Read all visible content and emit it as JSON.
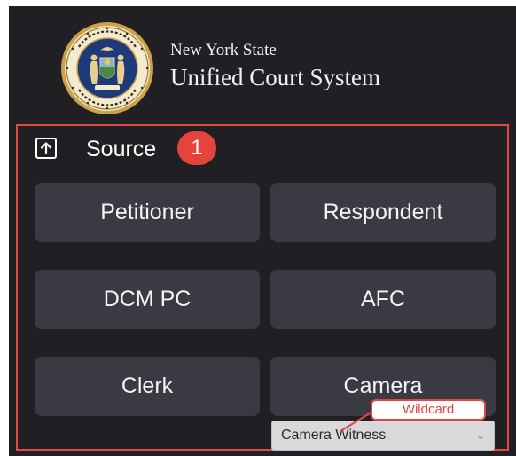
{
  "header": {
    "org_line1": "New York State",
    "org_line2": "Unified Court System",
    "seal_icon": "ny-state-seal-icon"
  },
  "source": {
    "icon": "upload-icon",
    "label": "Source",
    "step_badge": "1"
  },
  "roles": [
    {
      "label": "Petitioner"
    },
    {
      "label": "Respondent"
    },
    {
      "label": "DCM PC"
    },
    {
      "label": "AFC"
    },
    {
      "label": "Clerk"
    },
    {
      "label": "Camera"
    }
  ],
  "camera_select": {
    "selected": "Camera Witness",
    "icon": "chevron-down-icon"
  },
  "wildcard_callout": {
    "label": "Wildcard"
  },
  "colors": {
    "panel_background": "#202024",
    "button_background": "#3a3a42",
    "annotation_red": "#e04848",
    "badge_red": "#e4443c"
  }
}
